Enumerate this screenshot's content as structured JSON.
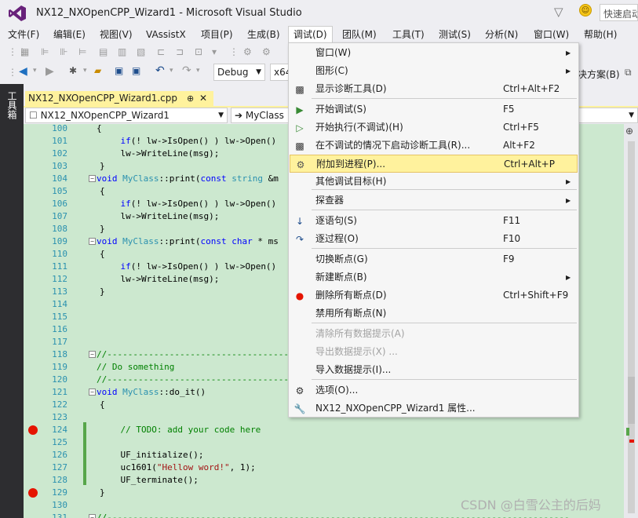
{
  "window": {
    "title": "NX12_NXOpenCPP_Wizard1 - Microsoft Visual Studio",
    "quick_launch": "快速启动"
  },
  "menubar": [
    {
      "label": "文件(F)"
    },
    {
      "label": "编辑(E)"
    },
    {
      "label": "视图(V)"
    },
    {
      "label": "VAssistX"
    },
    {
      "label": "项目(P)"
    },
    {
      "label": "生成(B)"
    },
    {
      "label": "调试(D)"
    },
    {
      "label": "团队(M)"
    },
    {
      "label": "工具(T)"
    },
    {
      "label": "测试(S)"
    },
    {
      "label": "分析(N)"
    },
    {
      "label": "窗口(W)"
    },
    {
      "label": "帮助(H)"
    }
  ],
  "toolbar": {
    "config": "Debug",
    "platform": "x64",
    "solution_fragment": "决方案(B)"
  },
  "toolbox": {
    "label": "工具箱"
  },
  "tab": {
    "filename": "NX12_NXOpenCPP_Wizard1.cpp",
    "pin": "⊕",
    "close": "✕"
  },
  "navigation": {
    "project": "NX12_NXOpenCPP_Wizard1",
    "scope": "MyClass"
  },
  "code_lines": [
    {
      "n": "100",
      "html": "<span>{</span>"
    },
    {
      "n": "101",
      "html": "    <span class='kw'>if</span>(! lw-&gt;IsOpen() ) lw-&gt;Open()"
    },
    {
      "n": "102",
      "html": "    lw-&gt;WriteLine(msg);"
    },
    {
      "n": "103",
      "html": "}"
    },
    {
      "n": "104",
      "html": "<span class='kw'>void</span> <span class='ty'>MyClass</span>::print(<span class='kw'>const</span> <span class='ty'>string</span> &amp;m"
    },
    {
      "n": "105",
      "html": "{"
    },
    {
      "n": "106",
      "html": "    <span class='kw'>if</span>(! lw-&gt;IsOpen() ) lw-&gt;Open()"
    },
    {
      "n": "107",
      "html": "    lw-&gt;WriteLine(msg);"
    },
    {
      "n": "108",
      "html": "}"
    },
    {
      "n": "109",
      "html": "<span class='kw'>void</span> <span class='ty'>MyClass</span>::print(<span class='kw'>const</span> <span class='kw'>char</span> * ms"
    },
    {
      "n": "110",
      "html": "{"
    },
    {
      "n": "111",
      "html": "    <span class='kw'>if</span>(! lw-&gt;IsOpen() ) lw-&gt;Open()"
    },
    {
      "n": "112",
      "html": "    lw-&gt;WriteLine(msg);"
    },
    {
      "n": "113",
      "html": "}"
    },
    {
      "n": "114",
      "html": ""
    },
    {
      "n": "115",
      "html": ""
    },
    {
      "n": "116",
      "html": ""
    },
    {
      "n": "117",
      "html": ""
    },
    {
      "n": "118",
      "html": "<span class='cm'>//--------------------------------------------</span>"
    },
    {
      "n": "119",
      "html": "<span class='cm'>// Do something</span>"
    },
    {
      "n": "120",
      "html": "<span class='cm'>//--------------------------------------------</span>"
    },
    {
      "n": "121",
      "html": "<span class='kw'>void</span> <span class='ty'>MyClass</span>::do_it()"
    },
    {
      "n": "122",
      "html": "{"
    },
    {
      "n": "123",
      "html": ""
    },
    {
      "n": "124",
      "html": "    <span class='cm'>// TODO: add your code here</span>"
    },
    {
      "n": "125",
      "html": ""
    },
    {
      "n": "126",
      "html": "    UF_initialize();"
    },
    {
      "n": "127",
      "html": "    uc1601(<span class='st'>\"Hellow word!\"</span>, 1);"
    },
    {
      "n": "128",
      "html": "    UF_terminate();"
    },
    {
      "n": "129",
      "html": "}"
    },
    {
      "n": "130",
      "html": ""
    },
    {
      "n": "131",
      "html": "<span class='cm'>//-----------------------------------------------------------------------------------------</span>"
    }
  ],
  "debug_menu": [
    {
      "label": "窗口(W)",
      "shortcut": "",
      "submenu": true,
      "icon": "",
      "state": "normal"
    },
    {
      "label": "图形(C)",
      "shortcut": "",
      "submenu": true,
      "icon": "",
      "state": "normal"
    },
    {
      "label": "显示诊断工具(D)",
      "shortcut": "Ctrl+Alt+F2",
      "submenu": false,
      "icon": "diagnostics-icon",
      "state": "normal"
    },
    {
      "label": "开始调试(S)",
      "shortcut": "F5",
      "submenu": false,
      "icon": "play-icon",
      "state": "normal"
    },
    {
      "label": "开始执行(不调试)(H)",
      "shortcut": "Ctrl+F5",
      "submenu": false,
      "icon": "play-outline-icon",
      "state": "normal"
    },
    {
      "label": "在不调试的情况下启动诊断工具(R)...",
      "shortcut": "Alt+F2",
      "submenu": false,
      "icon": "diagnostics-icon",
      "state": "normal"
    },
    {
      "label": "附加到进程(P)...",
      "shortcut": "Ctrl+Alt+P",
      "submenu": false,
      "icon": "attach-process-icon",
      "state": "highlighted"
    },
    {
      "label": "其他调试目标(H)",
      "shortcut": "",
      "submenu": true,
      "icon": "",
      "state": "normal"
    },
    {
      "label": "探查器",
      "shortcut": "",
      "submenu": true,
      "icon": "",
      "state": "normal"
    },
    {
      "label": "逐语句(S)",
      "shortcut": "F11",
      "submenu": false,
      "icon": "step-into-icon",
      "state": "normal"
    },
    {
      "label": "逐过程(O)",
      "shortcut": "F10",
      "submenu": false,
      "icon": "step-over-icon",
      "state": "normal"
    },
    {
      "label": "切换断点(G)",
      "shortcut": "F9",
      "submenu": false,
      "icon": "",
      "state": "normal"
    },
    {
      "label": "新建断点(B)",
      "shortcut": "",
      "submenu": true,
      "icon": "",
      "state": "normal"
    },
    {
      "label": "删除所有断点(D)",
      "shortcut": "Ctrl+Shift+F9",
      "submenu": false,
      "icon": "delete-breakpoints-icon",
      "state": "normal"
    },
    {
      "label": "禁用所有断点(N)",
      "shortcut": "",
      "submenu": false,
      "icon": "",
      "state": "normal"
    },
    {
      "label": "清除所有数据提示(A)",
      "shortcut": "",
      "submenu": false,
      "icon": "",
      "state": "disabled"
    },
    {
      "label": "导出数据提示(X) ...",
      "shortcut": "",
      "submenu": false,
      "icon": "",
      "state": "disabled"
    },
    {
      "label": "导入数据提示(I)...",
      "shortcut": "",
      "submenu": false,
      "icon": "",
      "state": "normal"
    },
    {
      "label": "选项(O)...",
      "shortcut": "",
      "submenu": false,
      "icon": "gear-icon",
      "state": "normal"
    },
    {
      "label": "NX12_NXOpenCPP_Wizard1 属性...",
      "shortcut": "",
      "submenu": false,
      "icon": "wrench-icon",
      "state": "normal"
    }
  ],
  "watermark": "CSDN @白雪公主的后妈"
}
